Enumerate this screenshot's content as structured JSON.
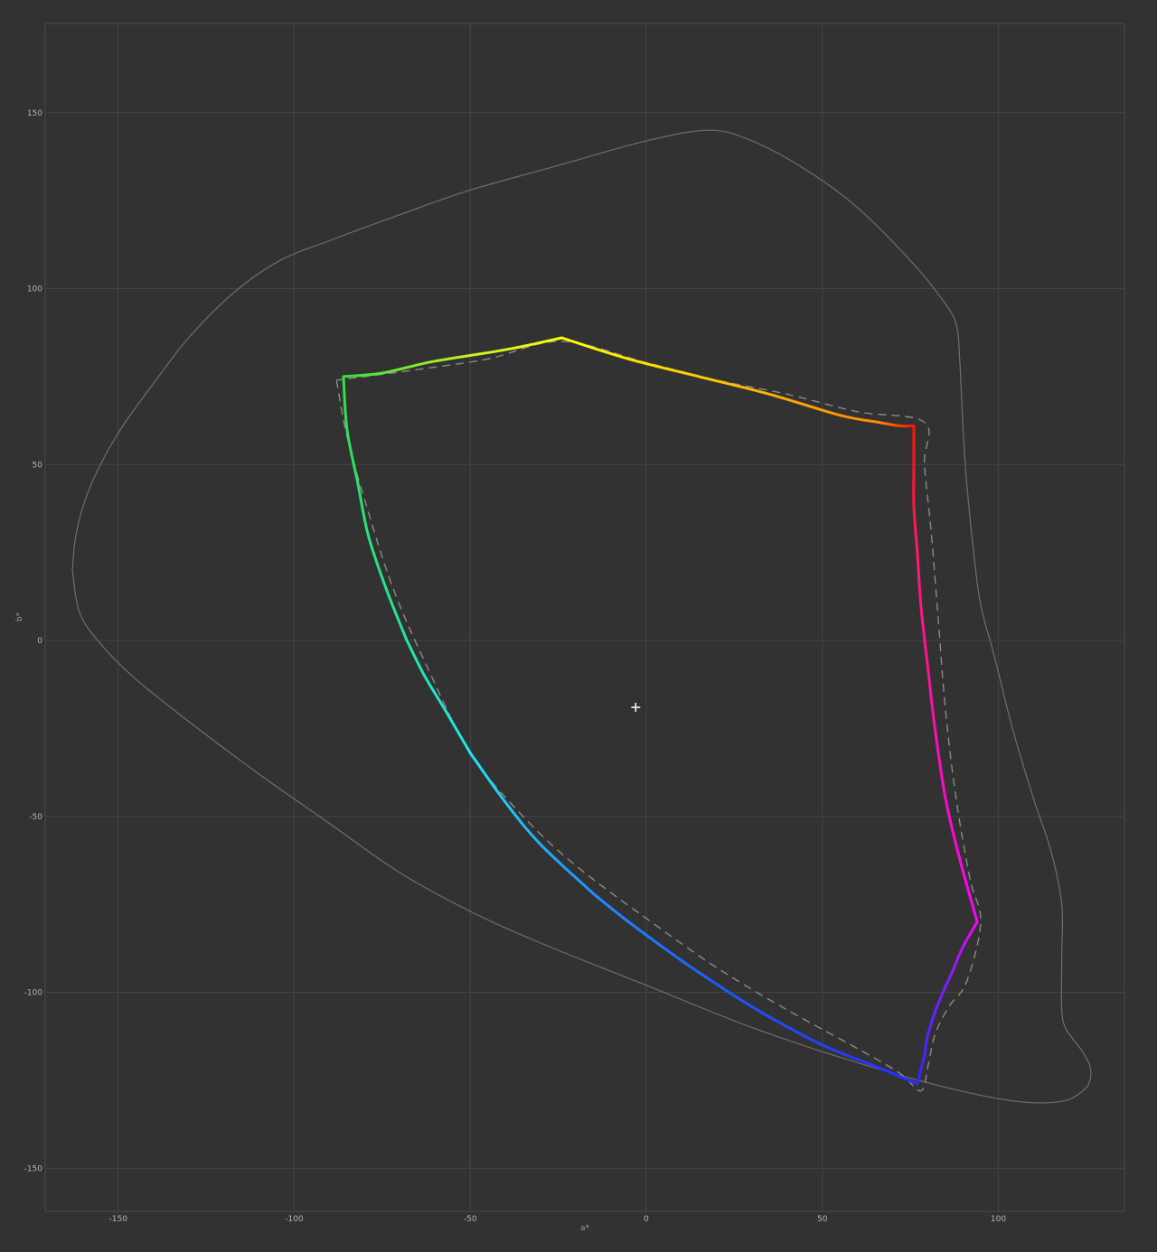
{
  "chart_data": {
    "type": "line",
    "xlabel": "a*",
    "ylabel": "b*",
    "xlim": [
      -172,
      136
    ],
    "ylim": [
      -162,
      175
    ],
    "xticks": [
      -150,
      -100,
      -50,
      0,
      50,
      100
    ],
    "yticks": [
      150,
      100,
      50,
      0,
      -50,
      -100,
      -150
    ],
    "grid": true,
    "colors": {
      "background": "#323232",
      "grid": "#444444",
      "frame": "#4a4a4a",
      "reference": "#8a8a8a",
      "visible_locus": "#6e6e6e"
    },
    "visible_locus": [
      [
        -163,
        20
      ],
      [
        -162,
        30
      ],
      [
        -159,
        41
      ],
      [
        -154,
        52
      ],
      [
        -148,
        62
      ],
      [
        -140,
        73
      ],
      [
        -130,
        86
      ],
      [
        -117,
        99
      ],
      [
        -104,
        108
      ],
      [
        -89,
        114
      ],
      [
        -70,
        121
      ],
      [
        -50,
        128
      ],
      [
        -25,
        135
      ],
      [
        0,
        142
      ],
      [
        18,
        145
      ],
      [
        30,
        142
      ],
      [
        45,
        134
      ],
      [
        60,
        123
      ],
      [
        75,
        108
      ],
      [
        84,
        97
      ],
      [
        88,
        90
      ],
      [
        89,
        80
      ],
      [
        90,
        60
      ],
      [
        91,
        45
      ],
      [
        93,
        25
      ],
      [
        95,
        10
      ],
      [
        99,
        -5
      ],
      [
        104,
        -25
      ],
      [
        110,
        -45
      ],
      [
        115,
        -60
      ],
      [
        118,
        -75
      ],
      [
        118,
        -90
      ],
      [
        118,
        -105
      ],
      [
        119,
        -110
      ],
      [
        121,
        -113
      ],
      [
        124,
        -117
      ],
      [
        126,
        -121
      ],
      [
        126,
        -125
      ],
      [
        124,
        -128
      ],
      [
        118,
        -131
      ],
      [
        105,
        -131
      ],
      [
        85,
        -127
      ],
      [
        60,
        -120
      ],
      [
        30,
        -110
      ],
      [
        0,
        -98
      ],
      [
        -30,
        -86
      ],
      [
        -50,
        -77
      ],
      [
        -70,
        -66
      ],
      [
        -90,
        -52
      ],
      [
        -110,
        -38
      ],
      [
        -130,
        -23
      ],
      [
        -145,
        -11
      ],
      [
        -155,
        -1
      ],
      [
        -161,
        8
      ],
      [
        -163,
        20
      ]
    ],
    "reference_gamut": [
      [
        -88,
        74
      ],
      [
        -85,
        58
      ],
      [
        -80,
        40
      ],
      [
        -72,
        15
      ],
      [
        -62,
        -8
      ],
      [
        -50,
        -32
      ],
      [
        -35,
        -50
      ],
      [
        -20,
        -64
      ],
      [
        0,
        -79
      ],
      [
        20,
        -93
      ],
      [
        40,
        -105
      ],
      [
        60,
        -116
      ],
      [
        72,
        -123
      ],
      [
        78,
        -128
      ],
      [
        80,
        -121
      ],
      [
        82,
        -112
      ],
      [
        86,
        -104
      ],
      [
        91,
        -97
      ],
      [
        95,
        -80
      ],
      [
        92,
        -68
      ],
      [
        88,
        -45
      ],
      [
        85,
        -20
      ],
      [
        83,
        5
      ],
      [
        81,
        30
      ],
      [
        79,
        50
      ],
      [
        79,
        62
      ],
      [
        60,
        65
      ],
      [
        40,
        70
      ],
      [
        20,
        74
      ],
      [
        0,
        79
      ],
      [
        -24,
        85
      ],
      [
        -45,
        80
      ],
      [
        -65,
        77
      ],
      [
        -80,
        75
      ],
      [
        -88,
        74
      ]
    ],
    "series": [
      {
        "name": "",
        "segments": [
          {
            "from": "#ffff00",
            "to": "#ff8800",
            "points": [
              [
                -24,
                86
              ],
              [
                -5,
                80
              ],
              [
                15,
                75
              ],
              [
                35,
                70
              ],
              [
                55,
                64
              ],
              [
                66,
                62
              ]
            ]
          },
          {
            "from": "#ff8800",
            "to": "#ff1500",
            "points": [
              [
                66,
                62
              ],
              [
                72,
                61
              ],
              [
                76,
                61
              ]
            ]
          },
          {
            "from": "#ff1500",
            "to": "#ff1a6e",
            "points": [
              [
                76,
                61
              ],
              [
                76,
                50
              ],
              [
                76,
                38
              ],
              [
                77,
                25
              ]
            ]
          },
          {
            "from": "#ff1a6e",
            "to": "#ff00ff",
            "points": [
              [
                77,
                25
              ],
              [
                78,
                10
              ],
              [
                80,
                -8
              ],
              [
                82,
                -25
              ],
              [
                85,
                -45
              ],
              [
                89,
                -62
              ],
              [
                94,
                -80
              ]
            ]
          },
          {
            "from": "#ff00ff",
            "to": "#8a1cff",
            "points": [
              [
                94,
                -80
              ],
              [
                90,
                -87
              ],
              [
                87,
                -94
              ]
            ]
          },
          {
            "from": "#8a1cff",
            "to": "#2a2aff",
            "points": [
              [
                87,
                -94
              ],
              [
                83,
                -103
              ],
              [
                80,
                -112
              ],
              [
                79,
                -118
              ],
              [
                78,
                -122
              ],
              [
                77,
                -126
              ]
            ]
          },
          {
            "from": "#2a2aff",
            "to": "#1a55ff",
            "points": [
              [
                77,
                -126
              ],
              [
                65,
                -121
              ],
              [
                50,
                -115
              ],
              [
                35,
                -107
              ],
              [
                25,
                -101
              ]
            ]
          },
          {
            "from": "#1a55ff",
            "to": "#1e90ff",
            "points": [
              [
                25,
                -101
              ],
              [
                10,
                -91
              ],
              [
                -5,
                -80
              ],
              [
                -15,
                -72
              ]
            ]
          },
          {
            "from": "#1e90ff",
            "to": "#1ee6f0",
            "points": [
              [
                -15,
                -72
              ],
              [
                -30,
                -58
              ],
              [
                -40,
                -46
              ],
              [
                -50,
                -32
              ]
            ]
          },
          {
            "from": "#1ee6f0",
            "to": "#22e6a0",
            "points": [
              [
                -50,
                -32
              ],
              [
                -57,
                -20
              ],
              [
                -63,
                -10
              ],
              [
                -68,
                0
              ]
            ]
          },
          {
            "from": "#22e6a0",
            "to": "#30e040",
            "points": [
              [
                -68,
                0
              ],
              [
                -74,
                15
              ],
              [
                -79,
                30
              ],
              [
                -82,
                45
              ],
              [
                -85,
                60
              ],
              [
                -86,
                75
              ]
            ]
          },
          {
            "from": "#30e040",
            "to": "#c8f028",
            "points": [
              [
                -86,
                75
              ],
              [
                -75,
                76
              ],
              [
                -62,
                79
              ],
              [
                -50,
                81
              ]
            ]
          },
          {
            "from": "#c8f028",
            "to": "#ffff00",
            "points": [
              [
                -50,
                81
              ],
              [
                -38,
                83
              ],
              [
                -24,
                86
              ]
            ]
          }
        ]
      }
    ],
    "white_point": [
      -3,
      -19
    ]
  }
}
